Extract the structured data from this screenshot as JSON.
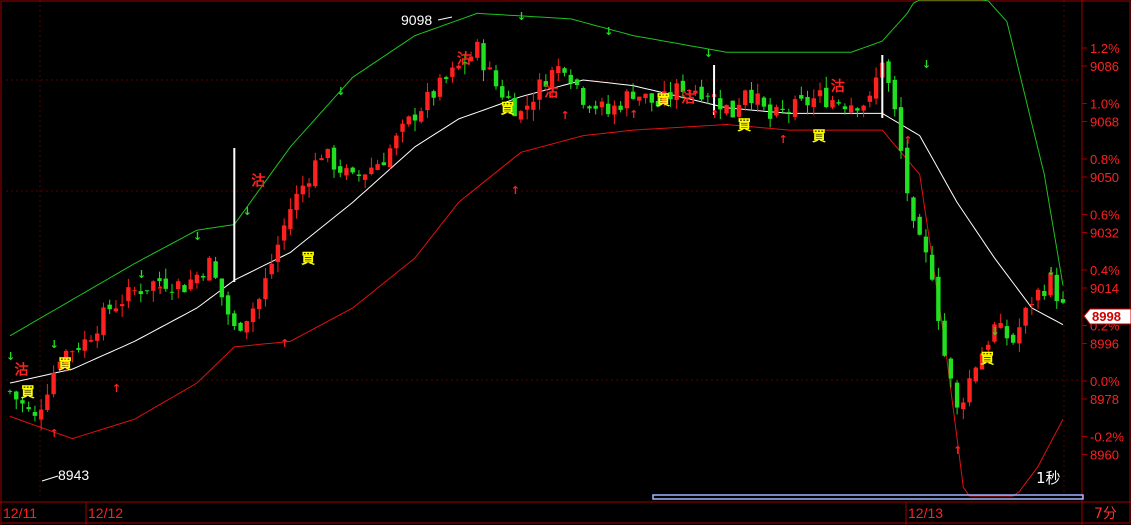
{
  "chart_data": {
    "type": "candlestick",
    "title": "",
    "xlabel": "",
    "ylabel": "",
    "ylim": [
      8943,
      9102
    ],
    "y_ticks": [
      {
        "price": "9086",
        "pct": "1.2%"
      },
      {
        "price": "9068",
        "pct": "1.0%"
      },
      {
        "price": "9050",
        "pct": "0.8%"
      },
      {
        "price": "9032",
        "pct": "0.6%"
      },
      {
        "price": "9014",
        "pct": "0.4%"
      },
      {
        "price": "8996",
        "pct": "0.2%"
      },
      {
        "price": "8978",
        "pct": "0.0%"
      },
      {
        "price": "8960",
        "pct": "-0.2%"
      }
    ],
    "x_labels": [
      "12/11",
      "12/12",
      "12/13"
    ],
    "current_price": "8998",
    "period_label": "7分",
    "refresh_label": "1秒",
    "high_label": "9098",
    "low_label": "8943",
    "colors": {
      "up": "#ff2020",
      "down": "#20e020",
      "mid": "#ffffff",
      "upper": "#1fc21f",
      "lower": "#e01010",
      "grid": "#5a0000",
      "axis": "#a00000",
      "buy": "#ffff00",
      "sell": "#ff2020"
    },
    "close_path": [
      [
        0,
        8972
      ],
      [
        4,
        8962
      ],
      [
        8,
        8985
      ],
      [
        12,
        8990
      ],
      [
        16,
        9002
      ],
      [
        20,
        9008
      ],
      [
        24,
        9012
      ],
      [
        28,
        9010
      ],
      [
        32,
        9018
      ],
      [
        36,
        8994
      ],
      [
        40,
        9005
      ],
      [
        45,
        9038
      ],
      [
        50,
        9058
      ],
      [
        55,
        9048
      ],
      [
        60,
        9056
      ],
      [
        65,
        9072
      ],
      [
        70,
        9084
      ],
      [
        75,
        9095
      ],
      [
        78,
        9082
      ],
      [
        82,
        9072
      ],
      [
        86,
        9085
      ],
      [
        89,
        9090
      ],
      [
        92,
        9078
      ],
      [
        96,
        9072
      ],
      [
        100,
        9080
      ],
      [
        104,
        9075
      ],
      [
        108,
        9082
      ],
      [
        112,
        9080
      ],
      [
        116,
        9072
      ],
      [
        118,
        9082
      ],
      [
        122,
        9070
      ],
      [
        126,
        9074
      ],
      [
        130,
        9078
      ],
      [
        134,
        9076
      ],
      [
        138,
        9076
      ],
      [
        140,
        9092
      ],
      [
        142,
        9072
      ],
      [
        145,
        9030
      ],
      [
        148,
        9015
      ],
      [
        150,
        8985
      ],
      [
        152,
        8965
      ],
      [
        155,
        8982
      ],
      [
        158,
        8995
      ],
      [
        161,
        8990
      ],
      [
        164,
        9005
      ],
      [
        167,
        9012
      ],
      [
        169,
        9002
      ]
    ],
    "series": [
      {
        "name": "",
        "values": [
          [
            0,
            8975
          ],
          [
            10,
            8980
          ],
          [
            20,
            8990
          ],
          [
            30,
            9002
          ],
          [
            36,
            9012
          ],
          [
            45,
            9022
          ],
          [
            55,
            9040
          ],
          [
            65,
            9060
          ],
          [
            72,
            9070
          ],
          [
            82,
            9078
          ],
          [
            92,
            9084
          ],
          [
            100,
            9082
          ],
          [
            115,
            9074
          ],
          [
            125,
            9072
          ],
          [
            140,
            9072
          ],
          [
            146,
            9064
          ],
          [
            152,
            9040
          ],
          [
            158,
            9020
          ],
          [
            164,
            9002
          ],
          [
            169,
            8996
          ]
        ]
      },
      {
        "name": "",
        "values": [
          [
            0,
            8992
          ],
          [
            10,
            9005
          ],
          [
            20,
            9018
          ],
          [
            30,
            9030
          ],
          [
            36,
            9032
          ],
          [
            45,
            9060
          ],
          [
            55,
            9085
          ],
          [
            65,
            9100
          ],
          [
            75,
            9108
          ],
          [
            90,
            9106
          ],
          [
            100,
            9100
          ],
          [
            115,
            9094
          ],
          [
            135,
            9094
          ],
          [
            140,
            9098
          ],
          [
            144,
            9108
          ],
          [
            150,
            9130
          ],
          [
            160,
            9105
          ],
          [
            166,
            9050
          ],
          [
            169,
            9010
          ]
        ]
      },
      {
        "name": "",
        "values": [
          [
            0,
            8963
          ],
          [
            10,
            8955
          ],
          [
            20,
            8962
          ],
          [
            30,
            8975
          ],
          [
            36,
            8988
          ],
          [
            45,
            8990
          ],
          [
            55,
            9002
          ],
          [
            65,
            9020
          ],
          [
            72,
            9040
          ],
          [
            82,
            9058
          ],
          [
            92,
            9064
          ],
          [
            100,
            9066
          ],
          [
            115,
            9068
          ],
          [
            125,
            9066
          ],
          [
            140,
            9066
          ],
          [
            146,
            9050
          ],
          [
            150,
            8990
          ],
          [
            154,
            8920
          ],
          [
            160,
            8930
          ],
          [
            165,
            8945
          ],
          [
            169,
            8962
          ]
        ]
      }
    ],
    "annotations": [
      {
        "text": "沽",
        "bar": 2,
        "price": 8978,
        "kind": "sell"
      },
      {
        "text": "買",
        "bar": 3,
        "price": 8970,
        "kind": "buy"
      },
      {
        "text": "買",
        "bar": 9,
        "price": 8980,
        "kind": "buy"
      },
      {
        "text": "沽",
        "bar": 40,
        "price": 9046,
        "kind": "sell"
      },
      {
        "text": "買",
        "bar": 48,
        "price": 9018,
        "kind": "buy"
      },
      {
        "text": "沽",
        "bar": 73,
        "price": 9090,
        "kind": "sell"
      },
      {
        "text": "買",
        "bar": 80,
        "price": 9072,
        "kind": "buy"
      },
      {
        "text": "沽",
        "bar": 87,
        "price": 9078,
        "kind": "sell"
      },
      {
        "text": "買",
        "bar": 105,
        "price": 9075,
        "kind": "buy"
      },
      {
        "text": "沽",
        "bar": 109,
        "price": 9076,
        "kind": "sell"
      },
      {
        "text": "買",
        "bar": 118,
        "price": 9066,
        "kind": "buy"
      },
      {
        "text": "沽",
        "bar": 133,
        "price": 9080,
        "kind": "sell"
      },
      {
        "text": "買",
        "bar": 130,
        "price": 9062,
        "kind": "buy"
      },
      {
        "text": "買",
        "bar": 157,
        "price": 8982,
        "kind": "buy"
      }
    ]
  }
}
